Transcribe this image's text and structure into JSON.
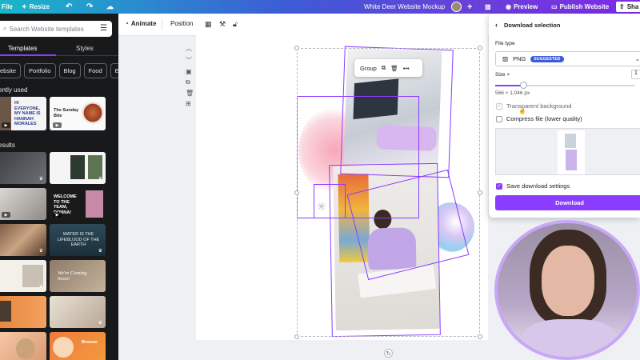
{
  "topbar": {
    "file": "File",
    "resize": "Resize",
    "doc_title": "White Deer Website Mockup",
    "preview": "Preview",
    "publish": "Publish Website",
    "share": "Sha"
  },
  "left": {
    "search_placeholder": "Search Website templates",
    "tabs": [
      "Templates",
      "Styles"
    ],
    "chips": [
      "ebsite",
      "Portfolio",
      "Blog",
      "Food",
      "E"
    ],
    "recent_label": "ently used",
    "results_label": "esults",
    "thumb_texts": {
      "hannah": "HI EVERYONE, MY NAME IS HANNAH MORALES",
      "sunday": "The Sunday Bite",
      "donna": "WELCOME TO THE TEAM, DONNA!",
      "water": "WATER IS THE LIFEBLOOD OF THE EARTH",
      "coming": "We're Coming Soon!",
      "browse": "Browse"
    }
  },
  "toolbar2": {
    "animate": "Animate",
    "position": "Position"
  },
  "canvas": {
    "group_label": "Group"
  },
  "download": {
    "title": "Download selection",
    "file_type_label": "File type",
    "file_type_value": "PNG",
    "suggested": "SUGGESTED",
    "size_label": "Size ×",
    "size_value": "1",
    "dimensions": "566 × 1,046 px",
    "size_fraction": 0.2,
    "transparent": "Transparent background",
    "compress": "Compress file (lower quality)",
    "save_settings": "Save download settings",
    "button": "Download"
  },
  "colors": {
    "accent": "#8b3dff",
    "panel_dark": "#18191b"
  }
}
